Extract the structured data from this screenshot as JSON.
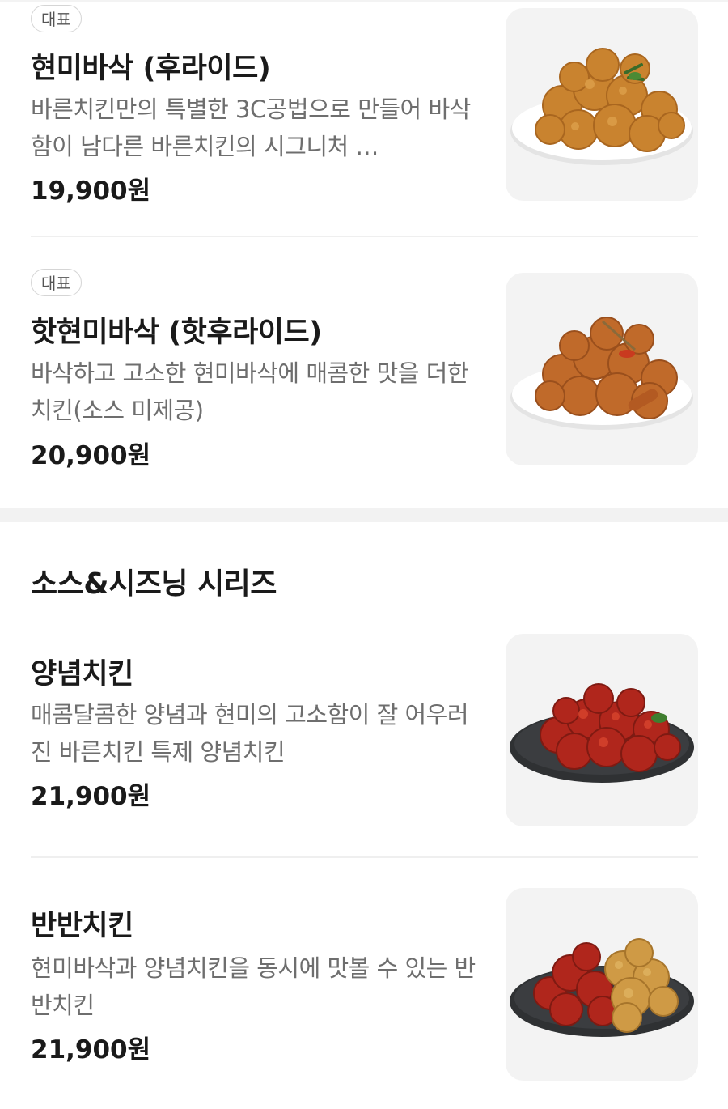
{
  "menu_sections": [
    {
      "items": [
        {
          "badge": "대표",
          "name": "현미바삭 (후라이드)",
          "description": "바른치킨만의 특별한 3C공법으로 만들어 바삭함이 남다른 바른치킨의 시그니처 …",
          "price": "19,900원",
          "image_icon": "fried-chicken-plate-icon"
        },
        {
          "badge": "대표",
          "name": "핫현미바삭 (핫후라이드)",
          "description": "바삭하고 고소한 현미바삭에 매콤한 맛을 더한 치킨(소스 미제공)",
          "price": "20,900원",
          "image_icon": "hot-fried-chicken-plate-icon"
        }
      ]
    },
    {
      "title": "소스&시즈닝 시리즈",
      "items": [
        {
          "name": "양념치킨",
          "description": "매콤달콤한 양념과 현미의 고소함이 잘 어우러진 바른치킨 특제 양념치킨",
          "price": "21,900원",
          "image_icon": "sauced-chicken-plate-icon"
        },
        {
          "name": "반반치킨",
          "description": "현미바삭과 양념치킨을 동시에 맛볼 수 있는 반반치킨",
          "price": "21,900원",
          "image_icon": "half-half-chicken-plate-icon"
        }
      ]
    }
  ],
  "colors": {
    "fried": "#c9832f",
    "hot_fried": "#c06a2a",
    "sauced": "#b0261c",
    "plate_white": "#ffffff",
    "plate_dark": "#2f3133"
  }
}
